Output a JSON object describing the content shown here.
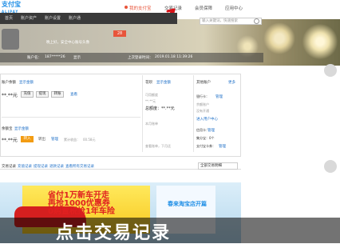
{
  "header": {
    "logo": "支付宝",
    "logo_sub": "ALIPAY",
    "nav": [
      {
        "label": "我的支付宝",
        "active": true
      },
      {
        "label": "交易记录",
        "active": false
      },
      {
        "label": "会员保障",
        "active": false
      },
      {
        "label": "应用中心",
        "active": false
      }
    ],
    "subnav": [
      "首页",
      "账户资产",
      "账户设置",
      "账户通"
    ],
    "search_placeholder": "输入关键词，快速搜索"
  },
  "banner": {
    "greeting": "晚上好，安全中心账号头像",
    "vip": "28",
    "account_label": "账户名：",
    "account_value": "187*****26",
    "account_link": "显示",
    "last_login_label": "上次登录时间：",
    "last_login_value": "2019.01.18 11:39:26"
  },
  "panel": {
    "balance_label": "账户余额",
    "balance_link": "显示金额",
    "balance_value": "**.**元",
    "balance_buttons": [
      "充值",
      "提现",
      "转账"
    ],
    "balance_more": "查看",
    "yuebao_label": "余额宝",
    "yuebao_link": "显示金额",
    "yuebao_value": "**.**元",
    "transfer_in": "转入",
    "yuebao_actions": [
      "转出",
      "管理"
    ],
    "yuebao_income": "累计收益：",
    "yuebao_income_value": "00.58元",
    "huabei_label": "花呗",
    "huabei_link": "显示金额",
    "huabei_avail": "可用额度",
    "huabei_avail_value": "**.**元",
    "huabei_total": "总额度：**.**元",
    "huabei_bill": "本月账单",
    "huabei_bill_more": "查看账单，下月还",
    "other_label": "其他账户",
    "other_more": "更多",
    "bank_card": "银行卡：",
    "bank_link": "管理",
    "remain": "余额账户",
    "no_account": "没有开通",
    "open_link": "进入用户中心",
    "credit": "信用卡：",
    "credit_link": "管理",
    "points": "集分宝：",
    "points_value": "0个",
    "alipay_card": "支付宝卡券：",
    "alipay_card_link": "管理"
  },
  "tabs": {
    "label": "交易记录",
    "items": [
      "充值记录",
      "提现记录",
      "退款记录",
      "查看所有交易记录"
    ],
    "filter": "全部交易明细"
  },
  "ad": {
    "line1": "省付1万新车开走",
    "line2": "再抢1000优惠券",
    "line3": "0购置税抢1年车险",
    "right": "春来淘宝店开篇"
  },
  "subtitle": "点击交易记录"
}
